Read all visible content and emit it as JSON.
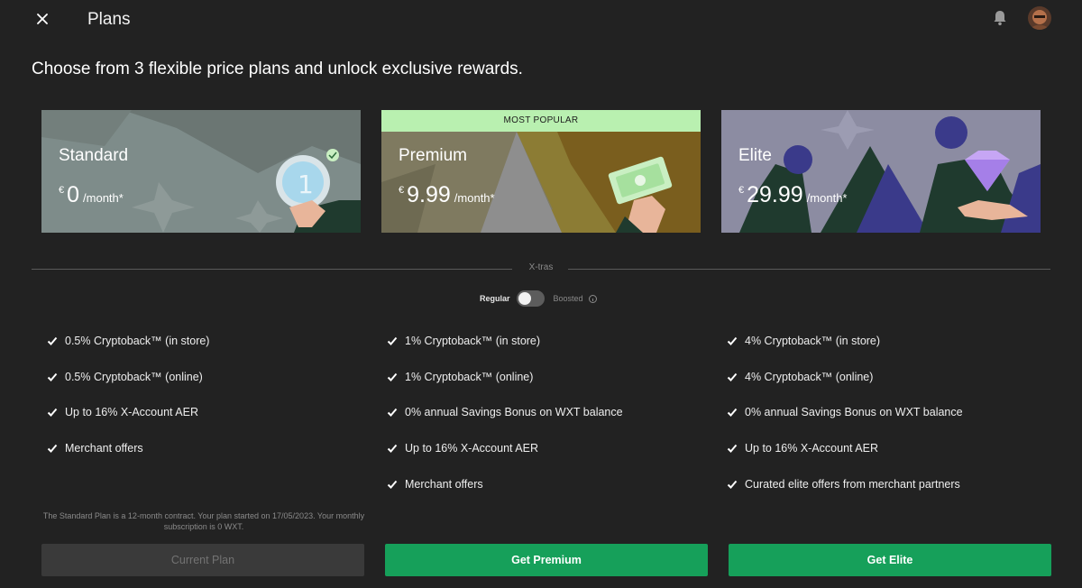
{
  "header": {
    "title": "Plans",
    "close_icon": "close-icon",
    "bell_icon": "bell-icon"
  },
  "headline": "Choose from 3 flexible price plans and unlock exclusive rewards.",
  "plans": [
    {
      "name": "Standard",
      "currency": "€",
      "price": "0",
      "period": "/month*",
      "features": [
        "0.5% Cryptoback™ (in store)",
        "0.5% Cryptoback™ (online)",
        "Up to 16% X-Account AER",
        "Merchant offers"
      ],
      "button_label": "Current Plan",
      "fine_print": "The Standard Plan is a 12-month contract. Your plan started on 17/05/2023. Your monthly subscription is 0 WXT."
    },
    {
      "name": "Premium",
      "badge": "MOST POPULAR",
      "currency": "€",
      "price": "9.99",
      "period": "/month*",
      "features": [
        "1% Cryptoback™ (in store)",
        "1% Cryptoback™ (online)",
        "0% annual Savings Bonus on WXT balance",
        "Up to 16% X-Account AER",
        "Merchant offers"
      ],
      "button_label": "Get Premium"
    },
    {
      "name": "Elite",
      "currency": "€",
      "price": "29.99",
      "period": "/month*",
      "features": [
        "4% Cryptoback™ (in store)",
        "4% Cryptoback™ (online)",
        "0% annual Savings Bonus on WXT balance",
        "Up to 16% X-Account AER",
        "Curated elite offers from merchant partners"
      ],
      "button_label": "Get Elite"
    }
  ],
  "xtras": {
    "label": "X-tras",
    "toggle_left": "Regular",
    "toggle_right": "Boosted",
    "selected": "Regular"
  },
  "colors": {
    "background": "#222222",
    "accent_green": "#16a05a",
    "badge_green": "#b9f0b0",
    "standard_card": "#7d8a88",
    "premium_card": "#8a7a30",
    "elite_card": "#8a8aa0"
  }
}
